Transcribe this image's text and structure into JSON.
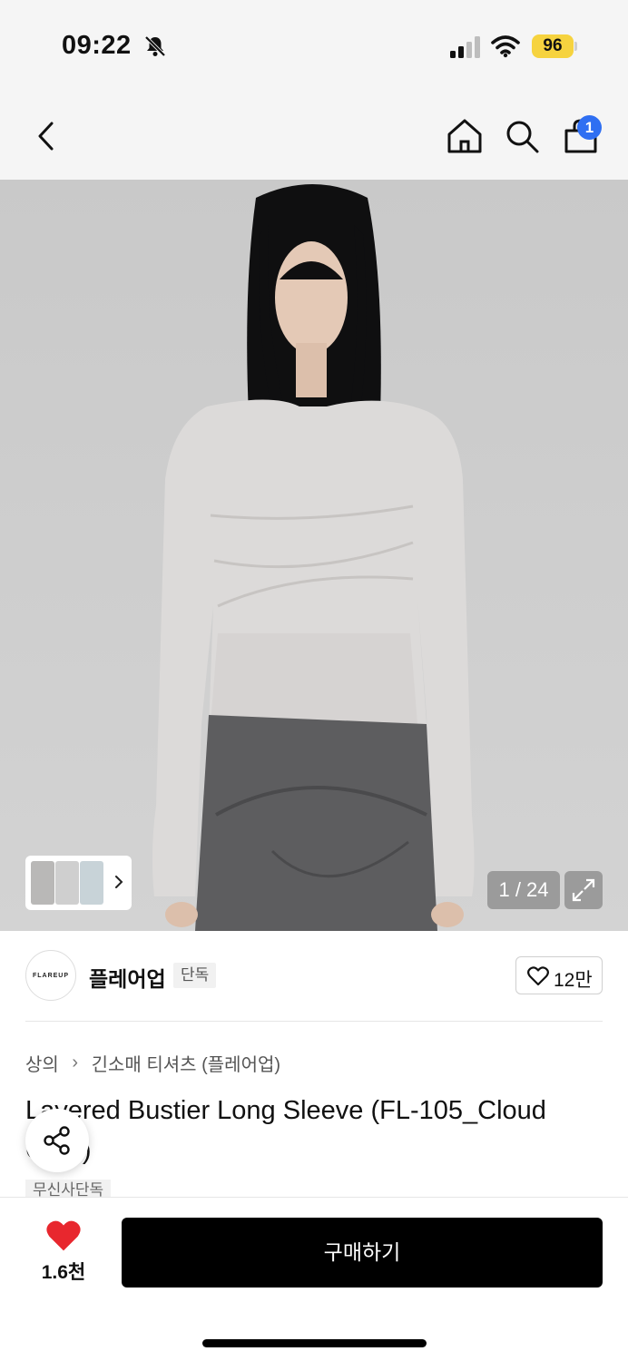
{
  "status_bar": {
    "time": "09:22",
    "battery": "96",
    "icons": [
      "bell-slash-icon",
      "signal-icon",
      "wifi-icon",
      "battery-icon"
    ]
  },
  "nav": {
    "icons": [
      "back-icon",
      "home-icon",
      "search-icon",
      "cart-icon"
    ],
    "cart_count": "1"
  },
  "gallery": {
    "counter": "1 / 24",
    "expand_icon": "expand-icon",
    "background": "#cfcfcf"
  },
  "brand": {
    "logo_text": "FLAREUP",
    "name": "플레어업",
    "tag": "단독",
    "likes": "12만"
  },
  "breadcrumb": {
    "items": [
      "상의",
      "긴소매 티셔츠 (플레어업)"
    ]
  },
  "product": {
    "title": "Layered Bustier Long Sleeve (FL-105_Cloud Grey)",
    "tag": "무신사단독"
  },
  "bottom_bar": {
    "like_count": "1.6천",
    "buy_label": "구매하기",
    "heart_color": "#e8272e"
  }
}
